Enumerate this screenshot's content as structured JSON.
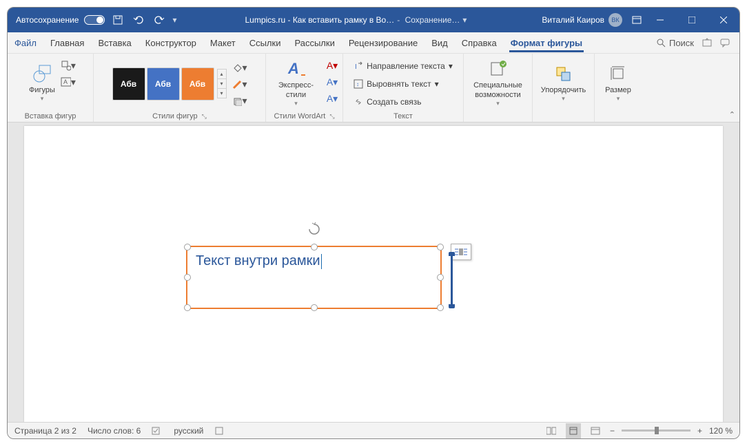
{
  "titlebar": {
    "autosave": "Автосохранение",
    "doc_title": "Lumpics.ru - Как вставить рамку в Во…",
    "saving": "Сохранение…",
    "user": "Виталий Каиров",
    "initials": "ВК"
  },
  "tabs": {
    "file": "Файл",
    "home": "Главная",
    "insert": "Вставка",
    "design": "Конструктор",
    "layout": "Макет",
    "references": "Ссылки",
    "mailings": "Рассылки",
    "review": "Рецензирование",
    "view": "Вид",
    "help": "Справка",
    "format": "Формат фигуры"
  },
  "search": "Поиск",
  "ribbon": {
    "shapes": "Фигуры",
    "insert_shapes": "Вставка фигур",
    "abv": "Абв",
    "shape_styles": "Стили фигур",
    "express": "Экспресс-стили",
    "wordart": "Стили WordArt",
    "text_group": "Текст",
    "text_dir": "Направление текста",
    "align_text": "Выровнять текст",
    "create_link": "Создать связь",
    "accessibility": "Специальные возможности",
    "arrange": "Упорядочить",
    "size": "Размер"
  },
  "canvas": {
    "shape_text": "Текст внутри рамки"
  },
  "status": {
    "page": "Страница 2 из 2",
    "words": "Число слов: 6",
    "lang": "русский",
    "zoom": "120 %"
  }
}
